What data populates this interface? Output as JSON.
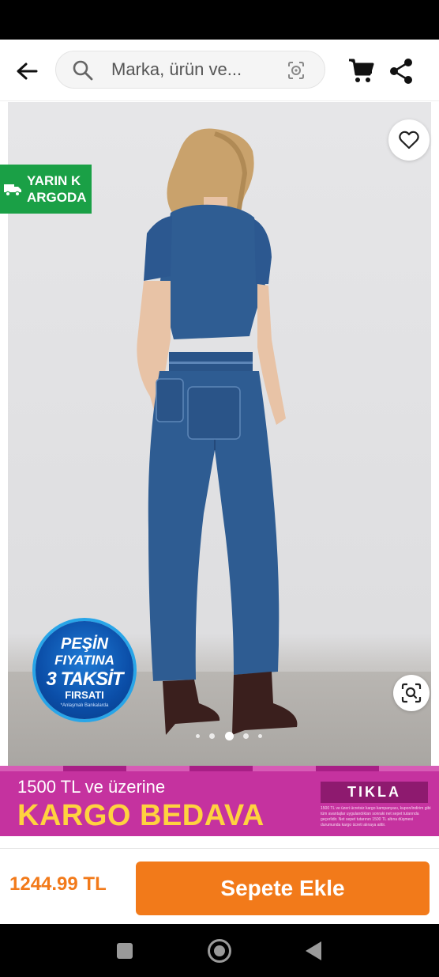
{
  "header": {
    "search_placeholder": "Marka, ürün ve..."
  },
  "product": {
    "delivery_badge": "YARIN K ARGODA",
    "installment_badge": {
      "line1": "PEŞİN",
      "line2": "FIYATINA",
      "line3": "3 TAKSİT",
      "line4": "FIRSATI",
      "line5": "*Anlaşmalı Bankalarda"
    },
    "image_count": 5,
    "active_image_index": 2
  },
  "promo": {
    "small_text": "1500 TL ve üzerine",
    "big_text": "KARGO BEDAVA",
    "cta": "TIKLA",
    "fine_print": "1500 TL ve üzeri ücretsiz kargo kampanyası, kupon/indirim gibi tüm avantajlar uygulandıktan sonraki net sepet tutarında geçerlidir. Net sepet tutarının 1500 TL altına düşmesi durumunda kargo ücreti alınaya aittir."
  },
  "bottom": {
    "price": "1244.99 TL",
    "add_to_cart": "Sepete Ekle"
  },
  "colors": {
    "accent": "#f27a1a",
    "delivery_green": "#1aa046",
    "promo_pink": "#c5329f",
    "promo_yellow": "#ffd23f"
  },
  "icons": [
    "arrow-left-icon",
    "search-icon",
    "camera-icon",
    "cart-icon",
    "share-icon",
    "heart-icon",
    "truck-icon",
    "zoom-scan-icon"
  ]
}
